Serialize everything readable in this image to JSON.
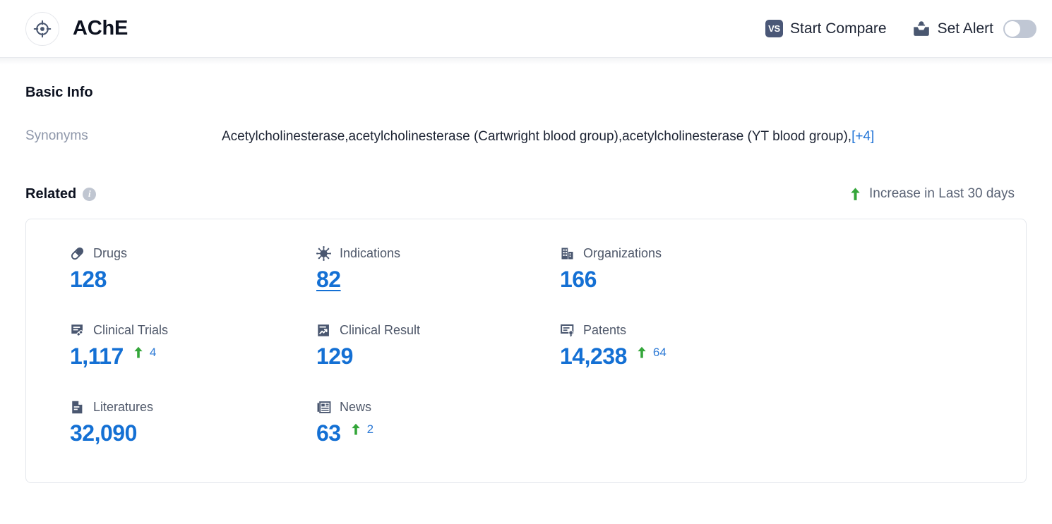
{
  "header": {
    "logo_icon": "target-icon",
    "title": "AChE",
    "compare_button": {
      "label": "Start Compare",
      "badge": "VS",
      "icon": "vs-badge-icon"
    },
    "alert_button": {
      "label": "Set Alert",
      "icon": "inbox-bell-icon"
    },
    "alert_toggle": {
      "state": "off"
    }
  },
  "basic_info": {
    "title": "Basic Info",
    "synonyms_label": "Synonyms",
    "synonyms_value": "Acetylcholinesterase,acetylcholinesterase (Cartwright blood group),acetylcholinesterase (YT blood group),",
    "synonyms_more": "[+4]"
  },
  "related": {
    "title": "Related",
    "info_icon": "info-icon",
    "info_glyph": "i",
    "legend": {
      "arrow": "arrow-up-icon",
      "label": "Increase in Last 30 days"
    },
    "stats": [
      {
        "icon": "pill-icon",
        "label": "Drugs",
        "value": "128",
        "delta": null,
        "linked": false
      },
      {
        "icon": "virus-icon",
        "label": "Indications",
        "value": "82",
        "delta": null,
        "linked": true
      },
      {
        "icon": "building-icon",
        "label": "Organizations",
        "value": "166",
        "delta": null,
        "linked": false
      },
      {
        "icon": "clinical-trial-icon",
        "label": "Clinical Trials",
        "value": "1,117",
        "delta": "4",
        "linked": false
      },
      {
        "icon": "clinical-result-icon",
        "label": "Clinical Result",
        "value": "129",
        "delta": null,
        "linked": false
      },
      {
        "icon": "patent-icon",
        "label": "Patents",
        "value": "14,238",
        "delta": "64",
        "linked": false
      },
      {
        "icon": "document-icon",
        "label": "Literatures",
        "value": "32,090",
        "delta": null,
        "linked": false
      },
      {
        "icon": "newspaper-icon",
        "label": "News",
        "value": "63",
        "delta": "2",
        "linked": false
      }
    ]
  },
  "colors": {
    "accent_blue": "#1470d4",
    "link_blue": "#2073d6",
    "increase_green": "#34a63a",
    "icon_slate": "#4a5770",
    "label_gray": "#4e5769",
    "muted_blue_gray": "#8d96a9"
  }
}
